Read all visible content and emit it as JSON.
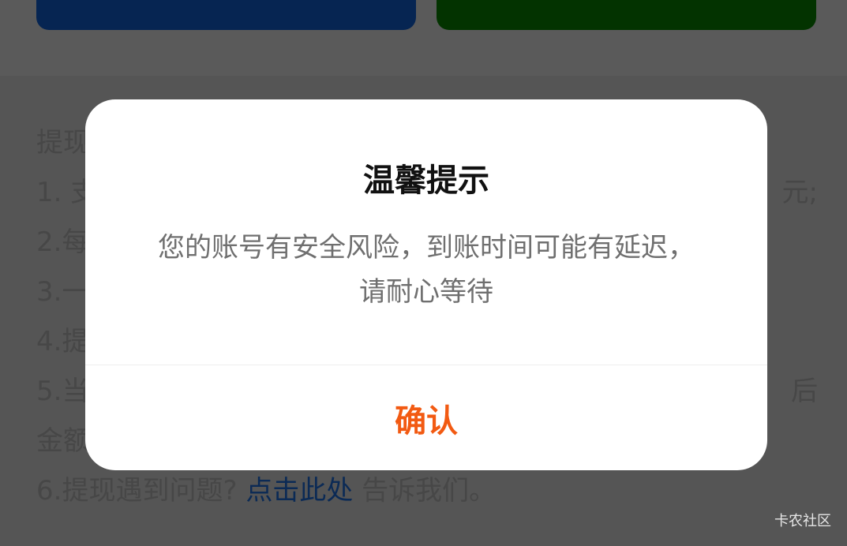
{
  "background": {
    "rules": {
      "line1_left": "提现",
      "line2_left": "1. 支",
      "line2_right": "元;",
      "line3_left": "2.每",
      "line4_left": "3.一",
      "line5_left": "4.提",
      "line6_left": "5.当",
      "line6_right": "后",
      "line7_left": "金额",
      "line8_prefix": "6.提现遇到问题?",
      "line8_link": "点击此处",
      "line8_suffix": "告诉我们。"
    },
    "card_colors": {
      "blue": "#062552",
      "green": "#033300"
    }
  },
  "dialog": {
    "title": "温馨提示",
    "message": "您的账号有安全风险，到账时间可能有延迟，请耐心等待",
    "confirm_label": "确认",
    "accent_color": "#f25a12"
  },
  "watermark": "卡农社区"
}
